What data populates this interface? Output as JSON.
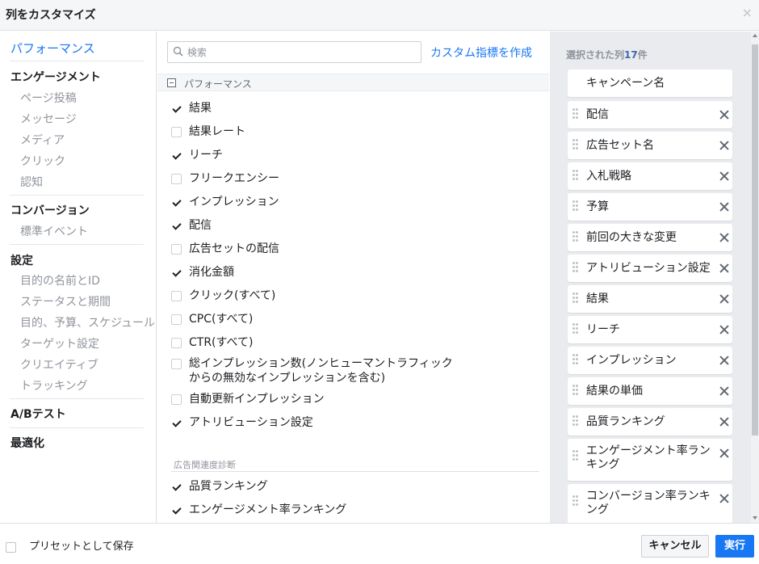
{
  "dialog": {
    "title": "列をカスタマイズ",
    "close_icon": "×"
  },
  "nav": {
    "performance": "パフォーマンス",
    "engagement": "エンゲージメント",
    "engagement_items": [
      "ページ投稿",
      "メッセージ",
      "メディア",
      "クリック",
      "認知"
    ],
    "conversion": "コンバージョン",
    "conversion_items": [
      "標準イベント"
    ],
    "settings": "設定",
    "settings_items": [
      "目的の名前とID",
      "ステータスと期間",
      "目的、予算、スケジュール",
      "ターゲット設定",
      "クリエイティブ",
      "トラッキング"
    ],
    "ab_test": "A/Bテスト",
    "optimization": "最適化"
  },
  "search": {
    "placeholder": "検索",
    "value": ""
  },
  "create_custom_metric": "カスタム指標を作成",
  "section": {
    "title": "パフォーマンス",
    "items": [
      {
        "label": "結果",
        "checked": true
      },
      {
        "label": "結果レート",
        "checked": false
      },
      {
        "label": "リーチ",
        "checked": true
      },
      {
        "label": "フリークエンシー",
        "checked": false
      },
      {
        "label": "インプレッション",
        "checked": true
      },
      {
        "label": "配信",
        "checked": true
      },
      {
        "label": "広告セットの配信",
        "checked": false
      },
      {
        "label": "消化金額",
        "checked": true
      },
      {
        "label": "クリック(すべて)",
        "checked": false
      },
      {
        "label": "CPC(すべて)",
        "checked": false
      },
      {
        "label": "CTR(すべて)",
        "checked": false
      },
      {
        "label": "総インプレッション数(ノンヒューマントラフィック\nからの無効なインプレッションを含む)",
        "checked": false
      },
      {
        "label": "自動更新インプレッション",
        "checked": false
      },
      {
        "label": "アトリビューション設定",
        "checked": true
      }
    ]
  },
  "subsection": {
    "title": "広告関連度診断",
    "items": [
      {
        "label": "品質ランキング",
        "checked": true
      },
      {
        "label": "エンゲージメント率ランキング",
        "checked": true
      }
    ]
  },
  "selected": {
    "title_prefix": "選択された列",
    "count": "17",
    "title_suffix": "件",
    "items": [
      {
        "label": "キャンペーン名",
        "removable": false
      },
      {
        "label": "配信",
        "removable": true
      },
      {
        "label": "広告セット名",
        "removable": true
      },
      {
        "label": "入札戦略",
        "removable": true
      },
      {
        "label": "予算",
        "removable": true
      },
      {
        "label": "前回の大きな変更",
        "removable": true
      },
      {
        "label": "アトリビューション設定",
        "removable": true
      },
      {
        "label": "結果",
        "removable": true
      },
      {
        "label": "リーチ",
        "removable": true
      },
      {
        "label": "インプレッション",
        "removable": true
      },
      {
        "label": "結果の単価",
        "removable": true
      },
      {
        "label": "品質ランキング",
        "removable": true
      },
      {
        "label": "エンゲージメント率ランキング",
        "removable": true
      },
      {
        "label": "コンバージョン率ランキング",
        "removable": true
      }
    ]
  },
  "footer": {
    "save_preset": "プリセットとして保存",
    "cancel": "キャンセル",
    "run": "実行"
  },
  "colors": {
    "accent": "#1877f2",
    "panel_bg": "#e9ebee"
  }
}
